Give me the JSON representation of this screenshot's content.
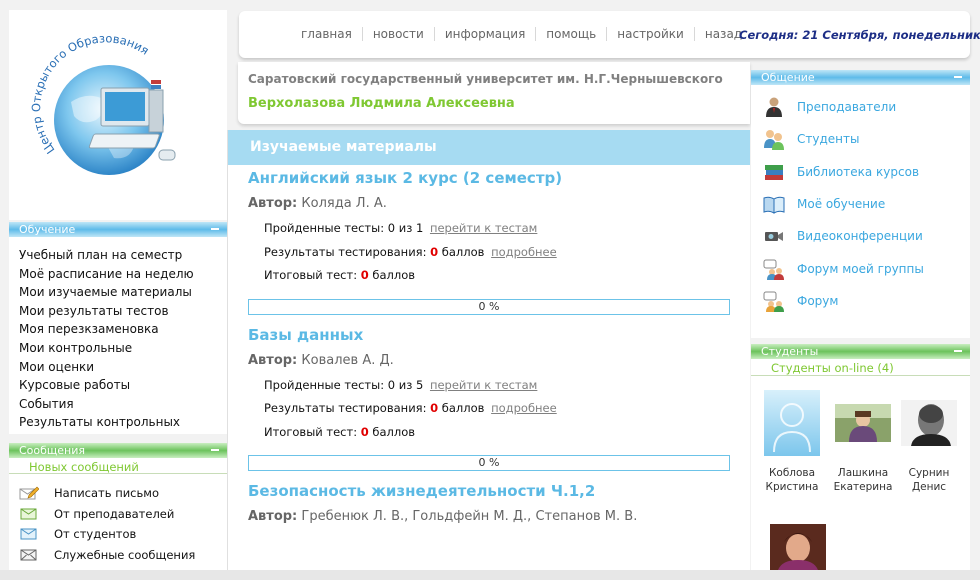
{
  "logo": {
    "arc_text": "Центр Открытого Образования"
  },
  "nav": {
    "items": [
      "главная",
      "новости",
      "информация",
      "помощь",
      "настройки",
      "назад"
    ],
    "date": "Сегодня: 21 Сентября, понедельник"
  },
  "header": {
    "university": "Саратовский государственный университет им. Н.Г.Чернышевского",
    "user": "Верхолазова Людмила Алексеевна"
  },
  "study": {
    "title": "Обучение",
    "items": [
      "Учебный план на семестр",
      "Моё расписание на неделю",
      "Мои изучаемые материалы",
      "Мои результаты тестов",
      "Моя перезкзаменовка",
      "Мои контрольные",
      "Мои оценки",
      "Курсовые работы",
      "События",
      "Результаты контрольных"
    ]
  },
  "messages": {
    "title": "Сообщения",
    "new_label": "Новых сообщений",
    "items": [
      {
        "label": "Написать письмо",
        "icon": "pencil-letter-icon"
      },
      {
        "label": "От преподавателей",
        "icon": "envelope-green-icon"
      },
      {
        "label": "От студентов",
        "icon": "envelope-blue-icon"
      },
      {
        "label": "Служебные сообщения",
        "icon": "envelope-gray-icon"
      }
    ]
  },
  "main": {
    "title": "Изучаемые материалы",
    "author_label": "Автор:",
    "passed_label": "Пройденные тесты:",
    "results_label": "Результаты тестирования:",
    "final_label": "Итоговый тест:",
    "points": "баллов",
    "goto_tests": "перейти к тестам",
    "details": "подробнее",
    "courses": [
      {
        "name": "Английский язык 2 курс (2 семестр)",
        "author": "Коляда Л. А.",
        "passed": "0 из 1",
        "results": "0",
        "final": "0",
        "progress": 0,
        "progress_text": "0 %"
      },
      {
        "name": "Базы данных",
        "author": "Ковалев А. Д.",
        "passed": "0 из 5",
        "results": "0",
        "final": "0",
        "progress": 0,
        "progress_text": "0 %"
      },
      {
        "name": "Безопасность жизнедеятельности Ч.1,2",
        "author": "Гребенюк Л. В., Гольдфейн М. Д., Степанов М. В."
      }
    ]
  },
  "comm": {
    "title": "Общение",
    "items": [
      {
        "label": "Преподаватели",
        "icon": "teacher-icon"
      },
      {
        "label": "Студенты",
        "icon": "students-icon"
      },
      {
        "label": "Библиотека курсов",
        "icon": "books-icon"
      },
      {
        "label": "Моё обучение",
        "icon": "open-book-icon"
      },
      {
        "label": "Видеоконференции",
        "icon": "video-camera-icon"
      },
      {
        "label": "Форум моей группы",
        "icon": "group-forum-icon"
      },
      {
        "label": "Форум",
        "icon": "forum-icon"
      }
    ]
  },
  "students": {
    "title": "Студенты",
    "online_label": "Студенты on-line (4)",
    "people": [
      {
        "first": "Коблова",
        "last": "Кристина",
        "photo": "placeholder"
      },
      {
        "first": "Лашкина",
        "last": "Екатерина",
        "photo": "outdoor"
      },
      {
        "first": "Сурнин",
        "last": "Денис",
        "photo": "bw-portrait"
      },
      {
        "first": "",
        "last": "",
        "photo": "woman-portrait"
      }
    ]
  },
  "colors": {
    "accent_blue": "#5bb9e4",
    "accent_green": "#7fc832",
    "title_bar": "#a6dbf2",
    "date_text": "#1d2e86",
    "score_red": "#e00000"
  }
}
